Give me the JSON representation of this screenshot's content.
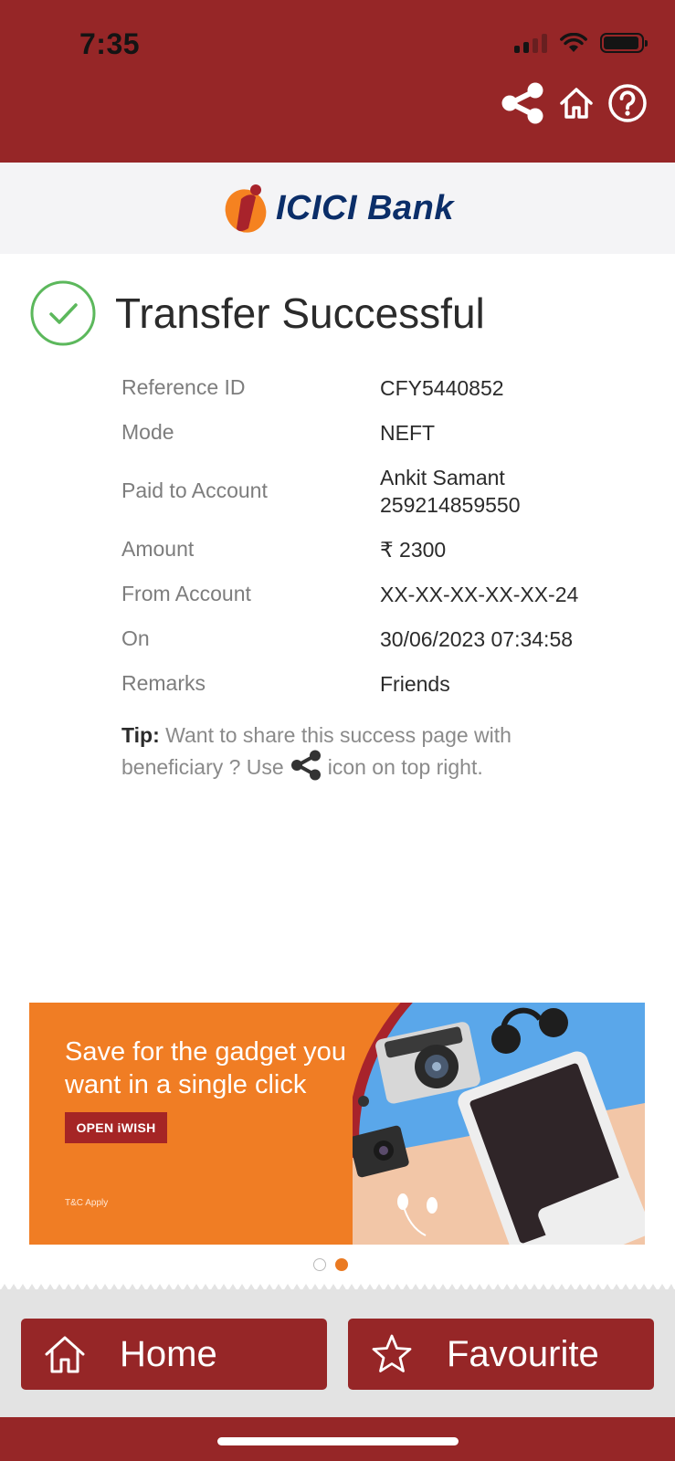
{
  "status_bar": {
    "time": "7:35"
  },
  "header": {
    "icons": [
      "share-icon",
      "home-icon",
      "help-icon"
    ]
  },
  "brand": {
    "logo_text": "ICICI Bank"
  },
  "result": {
    "title": "Transfer Successful",
    "details": [
      {
        "label": "Reference ID",
        "value": "CFY5440852"
      },
      {
        "label": "Mode",
        "value": "NEFT"
      },
      {
        "label": "Paid to Account",
        "value": "Ankit Samant",
        "value2": "259214859550"
      },
      {
        "label": "Amount",
        "value": "₹ 2300"
      },
      {
        "label": "From Account",
        "value": "XX-XX-XX-XX-XX-24"
      },
      {
        "label": "On",
        "value": "30/06/2023 07:34:58"
      },
      {
        "label": "Remarks",
        "value": "Friends"
      }
    ]
  },
  "tip": {
    "bold": "Tip:",
    "text_before": "Want to share this success page with beneficiary ? Use",
    "text_after": "icon on top right."
  },
  "banner": {
    "headline": "Save for the gadget you want in a single click",
    "button": "OPEN iWISH",
    "disclaimer": "T&C Apply"
  },
  "carousel": {
    "active_index": 1,
    "count": 2
  },
  "footer": {
    "home_label": "Home",
    "favourite_label": "Favourite"
  },
  "colors": {
    "brand_red": "#962627",
    "success_green": "#5cb85c",
    "banner_orange": "#f07d24",
    "active_dot": "#ea7a22"
  }
}
